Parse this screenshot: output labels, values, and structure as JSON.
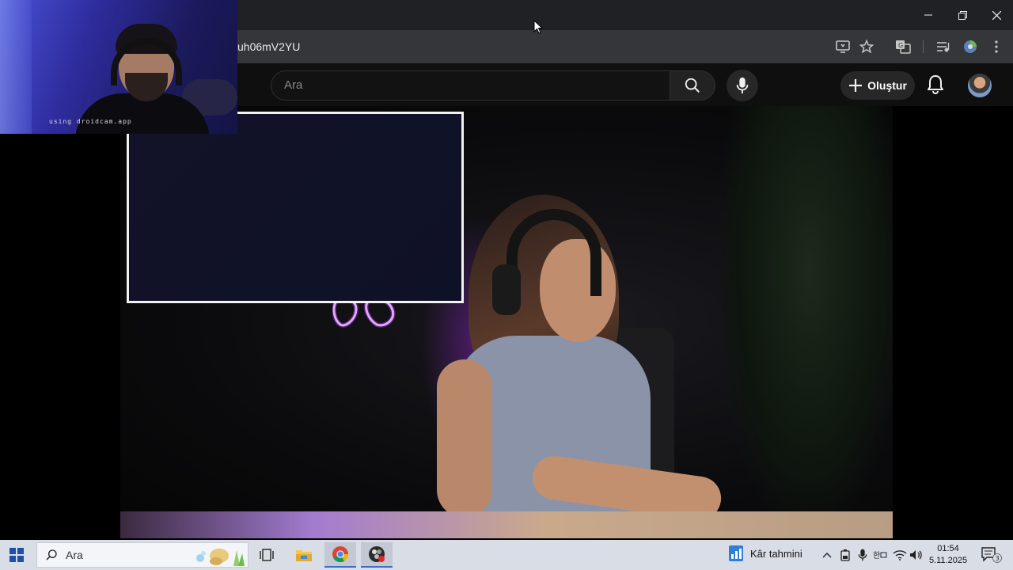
{
  "browser": {
    "url_text": "uh06mV2YU",
    "window_controls": [
      "minimize",
      "restore",
      "close"
    ],
    "toolbar_icons": [
      "install-app-icon",
      "bookmark-star-icon",
      "translate-icon",
      "media-controls-icon",
      "extensions-icon",
      "more-menu-icon"
    ]
  },
  "youtube": {
    "search_placeholder": "Ara",
    "create_label": "Oluştur",
    "icons": [
      "search-icon",
      "mic-icon",
      "plus-icon",
      "bell-icon"
    ]
  },
  "webcam": {
    "watermark": "using droidcam.app"
  },
  "taskbar": {
    "search_placeholder": "Ara",
    "weather_label": "Kâr tahmini",
    "time": "01:54",
    "date": "5.11.2025",
    "notification_count": "3",
    "apps": [
      "task-view-icon",
      "file-explorer-icon",
      "chrome-icon",
      "obs-icon"
    ],
    "tray_icons": [
      "chevron-up-icon",
      "battery-icon",
      "mic-icon",
      "keyboard-icon",
      "wifi-icon",
      "volume-icon"
    ]
  },
  "colors": {
    "chrome_titlebar": "#202124",
    "chrome_toolbar": "#35363a",
    "youtube_bg": "#0f0f0f",
    "taskbar_bg": "#d9dde6",
    "neon_accent": "#c040ff"
  }
}
